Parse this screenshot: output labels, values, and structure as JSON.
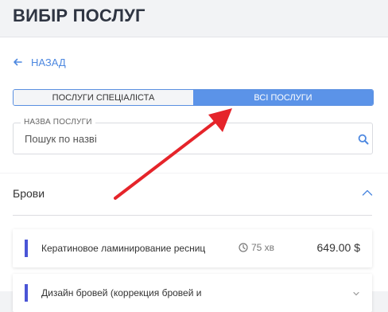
{
  "header": {
    "title": "ВИБІР ПОСЛУГ"
  },
  "nav": {
    "back_label": "НАЗАД"
  },
  "tabs": [
    {
      "label": "ПОСЛУГИ СПЕЦІАЛІСТА",
      "active": false
    },
    {
      "label": "ВСІ ПОСЛУГИ",
      "active": true
    }
  ],
  "search": {
    "label": "НАЗВА ПОСЛУГИ",
    "placeholder": "Пошук по назві",
    "value": ""
  },
  "category": {
    "title": "Брови",
    "expanded": true,
    "services": [
      {
        "name": "Кератиновое ламинирование ресниц",
        "duration": "75 хв",
        "price": "649.00 $"
      },
      {
        "name": "Дизайн бровей (коррекция бровей и",
        "duration": "",
        "price": ""
      }
    ]
  },
  "colors": {
    "accent": "#5b93e8",
    "service_marker": "#4a55d6",
    "annotation_arrow": "#e5242a"
  },
  "icons": {
    "back": "arrow-left-icon",
    "search": "search-icon",
    "collapse": "chevron-up-icon",
    "duration": "clock-icon"
  }
}
